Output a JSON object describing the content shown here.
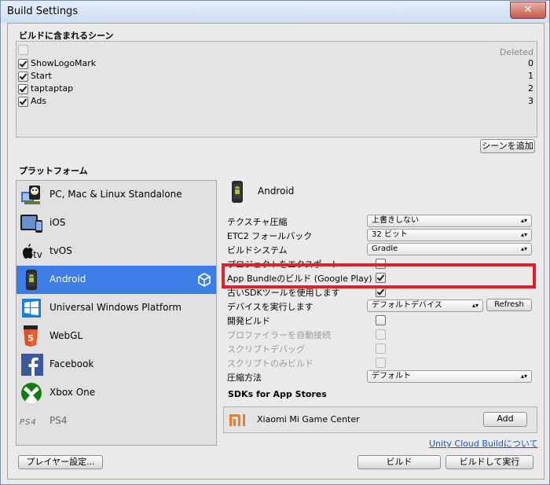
{
  "window": {
    "title": "Build Settings",
    "close_glyph": "✕"
  },
  "scenes": {
    "section_label": "ビルドに含まれるシーン",
    "deleted_label": "Deleted",
    "items": [
      {
        "name": "ShowLogoMark",
        "index": "0",
        "checked": true
      },
      {
        "name": "Start",
        "index": "1",
        "checked": true
      },
      {
        "name": "taptaptap",
        "index": "2",
        "checked": true
      },
      {
        "name": "Ads",
        "index": "3",
        "checked": true
      }
    ],
    "add_button": "シーンを追加"
  },
  "platforms": {
    "section_label": "プラットフォーム",
    "items": [
      {
        "label": "PC, Mac & Linux Standalone",
        "icon": "pc-mac-linux-icon"
      },
      {
        "label": "iOS",
        "icon": "ios-device-icon"
      },
      {
        "label": "tvOS",
        "icon": "apple-tv-icon"
      },
      {
        "label": "Android",
        "icon": "android-phone-icon",
        "selected": true
      },
      {
        "label": "Universal Windows Platform",
        "icon": "windows-icon"
      },
      {
        "label": "WebGL",
        "icon": "html5-icon"
      },
      {
        "label": "Facebook",
        "icon": "facebook-icon"
      },
      {
        "label": "Xbox One",
        "icon": "xbox-icon"
      },
      {
        "label": "PS4",
        "icon": "ps4-icon"
      }
    ],
    "selected_badge_icon": "unity-logo-icon"
  },
  "android": {
    "header": "Android",
    "settings": [
      {
        "label": "テクスチャ圧縮",
        "type": "dropdown",
        "value": "上書きしない"
      },
      {
        "label": "ETC2 フォールバック",
        "type": "dropdown",
        "value": "32 ビット"
      },
      {
        "label": "ビルドシステム",
        "type": "dropdown",
        "value": "Gradle"
      },
      {
        "label": "プロジェクトをエクスポート",
        "type": "checkbox",
        "checked": false
      },
      {
        "label": "App Bundleのビルド (Google Play)",
        "type": "checkbox",
        "checked": true
      },
      {
        "label": "古いSDKツールを使用します",
        "type": "checkbox",
        "checked": true
      },
      {
        "label": "デバイスを実行します",
        "type": "dropdown",
        "value": "デフォルトデバイス",
        "button": "Refresh"
      },
      {
        "label": "開発ビルド",
        "type": "checkbox",
        "checked": false
      },
      {
        "label": "プロファイラーを自動接続",
        "type": "checkbox",
        "checked": false,
        "disabled": true
      },
      {
        "label": "スクリプトデバッグ",
        "type": "checkbox",
        "checked": false,
        "disabled": true
      },
      {
        "label": "スクリプトのみビルド",
        "type": "checkbox",
        "checked": false,
        "disabled": true
      },
      {
        "label": "圧縮方法",
        "type": "dropdown",
        "value": "デフォルト"
      }
    ],
    "sdk_section_label": "SDKs for App Stores",
    "sdk_item": {
      "name": "Xiaomi Mi Game Center",
      "icon": "xiaomi-mi-icon",
      "button": "Add"
    },
    "cloud_link": "Unity Cloud Buildについて"
  },
  "footer": {
    "player_settings": "プレイヤー設定...",
    "build": "ビルド",
    "build_and_run": "ビルドして実行"
  },
  "colors": {
    "selection": "#3d7ee6",
    "highlight": "#e41e2a",
    "link": "#1b57c7"
  }
}
